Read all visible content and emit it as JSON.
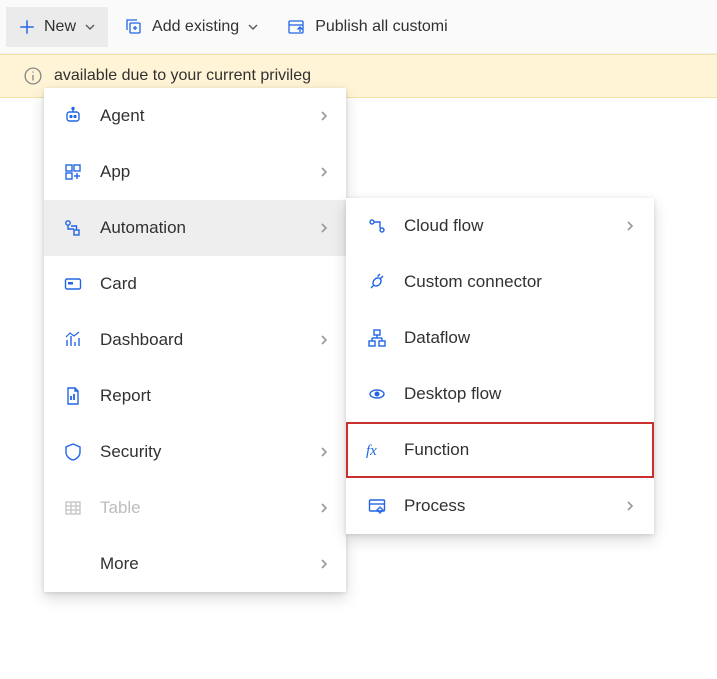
{
  "toolbar": {
    "new_label": "New",
    "add_existing_label": "Add existing",
    "publish_label": "Publish all customi"
  },
  "notice": {
    "text": "available due to your current privileg"
  },
  "menu": {
    "items": [
      {
        "label": "Agent",
        "icon": "agent-icon",
        "has_sub": true
      },
      {
        "label": "App",
        "icon": "app-icon",
        "has_sub": true
      },
      {
        "label": "Automation",
        "icon": "automation-icon",
        "has_sub": true,
        "hover": true
      },
      {
        "label": "Card",
        "icon": "card-icon",
        "has_sub": false
      },
      {
        "label": "Dashboard",
        "icon": "dashboard-icon",
        "has_sub": true
      },
      {
        "label": "Report",
        "icon": "report-icon",
        "has_sub": false
      },
      {
        "label": "Security",
        "icon": "security-icon",
        "has_sub": true
      },
      {
        "label": "Table",
        "icon": "table-icon",
        "has_sub": true,
        "disabled": true
      },
      {
        "label": "More",
        "icon": "",
        "has_sub": true,
        "more": true
      }
    ]
  },
  "submenu": {
    "items": [
      {
        "label": "Cloud flow",
        "icon": "cloud-flow-icon",
        "has_sub": true
      },
      {
        "label": "Custom connector",
        "icon": "custom-connector-icon",
        "has_sub": false
      },
      {
        "label": "Dataflow",
        "icon": "dataflow-icon",
        "has_sub": false
      },
      {
        "label": "Desktop flow",
        "icon": "desktop-flow-icon",
        "has_sub": false
      },
      {
        "label": "Function",
        "icon": "function-icon",
        "has_sub": false,
        "highlight": true
      },
      {
        "label": "Process",
        "icon": "process-icon",
        "has_sub": true
      }
    ]
  }
}
